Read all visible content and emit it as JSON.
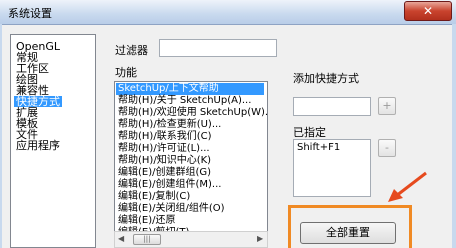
{
  "window": {
    "title": "系统设置",
    "close_label": "✕"
  },
  "categories": {
    "items": [
      "OpenGL",
      "常规",
      "工作区",
      "绘图",
      "兼容性",
      "快捷方式",
      "扩展",
      "模板",
      "文件",
      "应用程序"
    ],
    "selected_index": 5
  },
  "filter": {
    "label": "过滤器",
    "value": ""
  },
  "functions": {
    "label": "功能",
    "items": [
      "SketchUp/上下文帮助",
      "帮助(H)/关于 SketchUp(A)...",
      "帮助(H)/欢迎使用 SketchUp(W)...",
      "帮助(H)/检查更新(U)...",
      "帮助(H)/联系我们(C)",
      "帮助(H)/许可证(L)...",
      "帮助(H)/知识中心(K)",
      "编辑(E)/创建群组(G)",
      "编辑(E)/创建组件(M)...",
      "编辑(E)/复制(C)",
      "编辑(E)/关闭组/组件(O)",
      "编辑(E)/还原",
      "编辑(E)/剪切(T)"
    ],
    "selected_index": 0
  },
  "add_shortcut": {
    "label": "添加快捷方式",
    "value": "",
    "add_button": "+"
  },
  "assigned": {
    "label": "已指定",
    "items": [
      "Shift+F1"
    ],
    "remove_button": "-"
  },
  "reset_all_button": "全部重置",
  "scrollbar": {
    "left_arrow": "◀",
    "right_arrow": "▶",
    "thumb_grip": "|||"
  }
}
